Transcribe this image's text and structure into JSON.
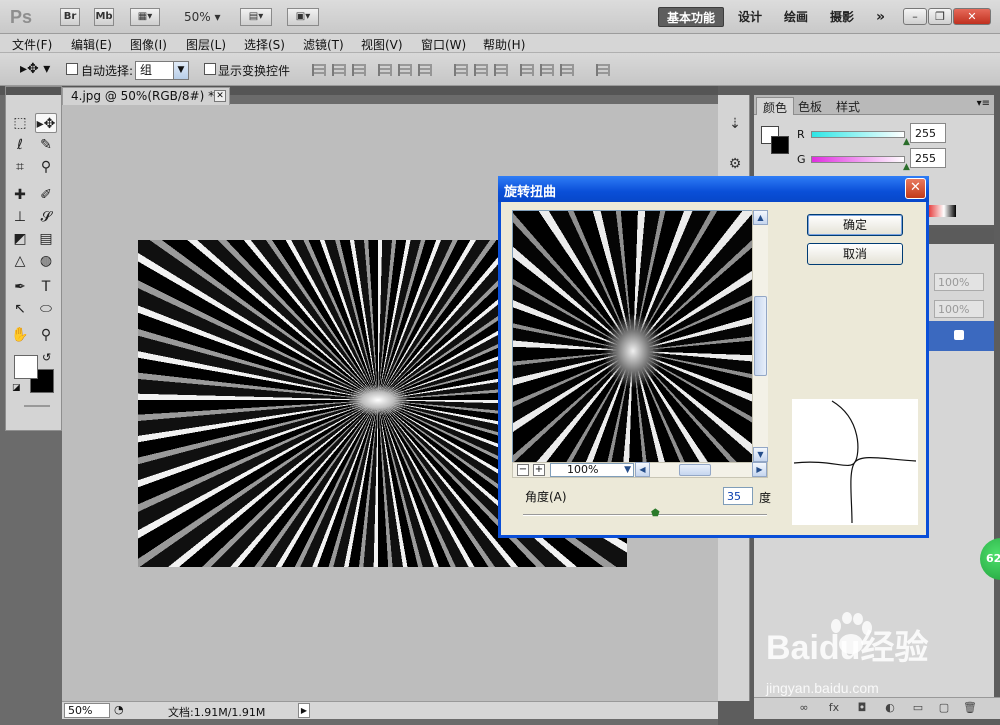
{
  "app": {
    "logo": "Ps",
    "bridge": "Br",
    "mini_bridge": "Mb",
    "zoom": "50%",
    "workspaces": [
      "基本功能",
      "设计",
      "绘画",
      "摄影"
    ],
    "more": "»",
    "window_controls": [
      "–",
      "❐",
      "✕"
    ]
  },
  "menu": [
    "文件(F)",
    "编辑(E)",
    "图像(I)",
    "图层(L)",
    "选择(S)",
    "滤镜(T)",
    "视图(V)",
    "窗口(W)",
    "帮助(H)"
  ],
  "options": {
    "auto_select_label": "自动选择:",
    "auto_select_value": "组",
    "show_transform_label": "显示变换控件"
  },
  "document": {
    "tab_title": "4.jpg @ 50%(RGB/8#) *",
    "tab_close": "✕",
    "status_zoom": "50%",
    "status_info": "文档:1.91M/1.91M"
  },
  "color_panel": {
    "tabs": [
      "颜色",
      "色板",
      "样式"
    ],
    "channels": [
      {
        "label": "R",
        "value": "255"
      },
      {
        "label": "G",
        "value": "255"
      }
    ]
  },
  "layers_panel": {
    "opacity": "100%",
    "fill": "100%"
  },
  "dialog": {
    "title": "旋转扭曲",
    "close": "✕",
    "ok_label": "确定",
    "cancel_label": "取消",
    "preview_zoom": "100%",
    "angle_label": "角度(A)",
    "angle_value": "35",
    "angle_unit": "度"
  },
  "badge": "62",
  "watermark": {
    "brand": "Baidu经验",
    "url": "jingyan.baidu.com"
  },
  "colors": {
    "dialog_title": "#0a4fd8",
    "layer_selected": "#3b69bf",
    "r_slider": "#2ee6e6",
    "g_slider": "#e02ee0"
  }
}
